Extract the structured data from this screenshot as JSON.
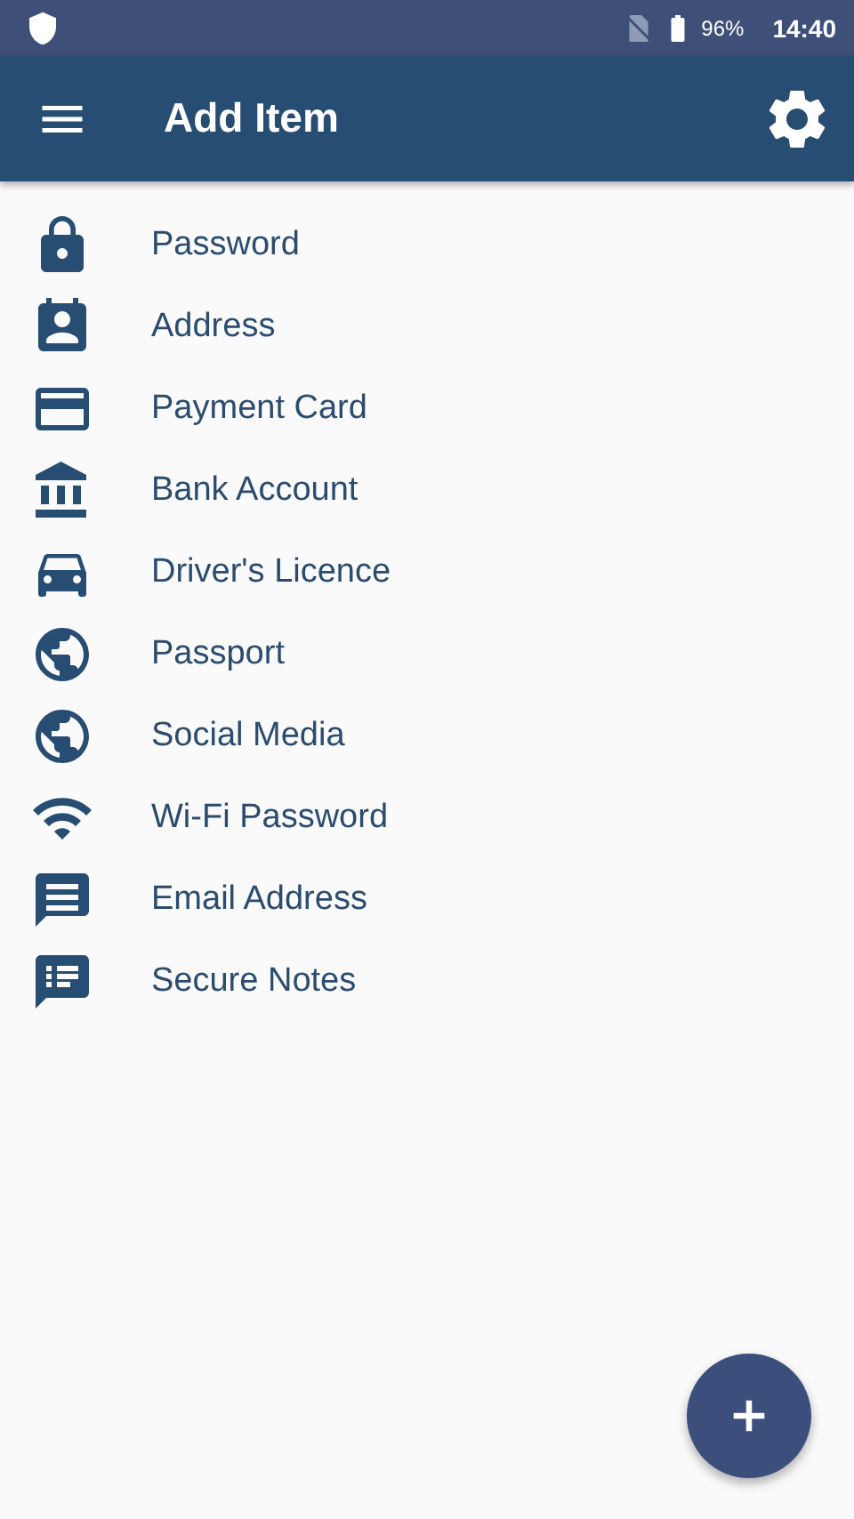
{
  "status_bar": {
    "battery": "96%",
    "time": "14:40"
  },
  "toolbar": {
    "title": "Add Item"
  },
  "items": [
    {
      "label": "Password"
    },
    {
      "label": "Address"
    },
    {
      "label": "Payment Card"
    },
    {
      "label": "Bank Account"
    },
    {
      "label": "Driver's Licence"
    },
    {
      "label": "Passport"
    },
    {
      "label": "Social Media"
    },
    {
      "label": "Wi-Fi Password"
    },
    {
      "label": "Email Address"
    },
    {
      "label": "Secure Notes"
    }
  ]
}
